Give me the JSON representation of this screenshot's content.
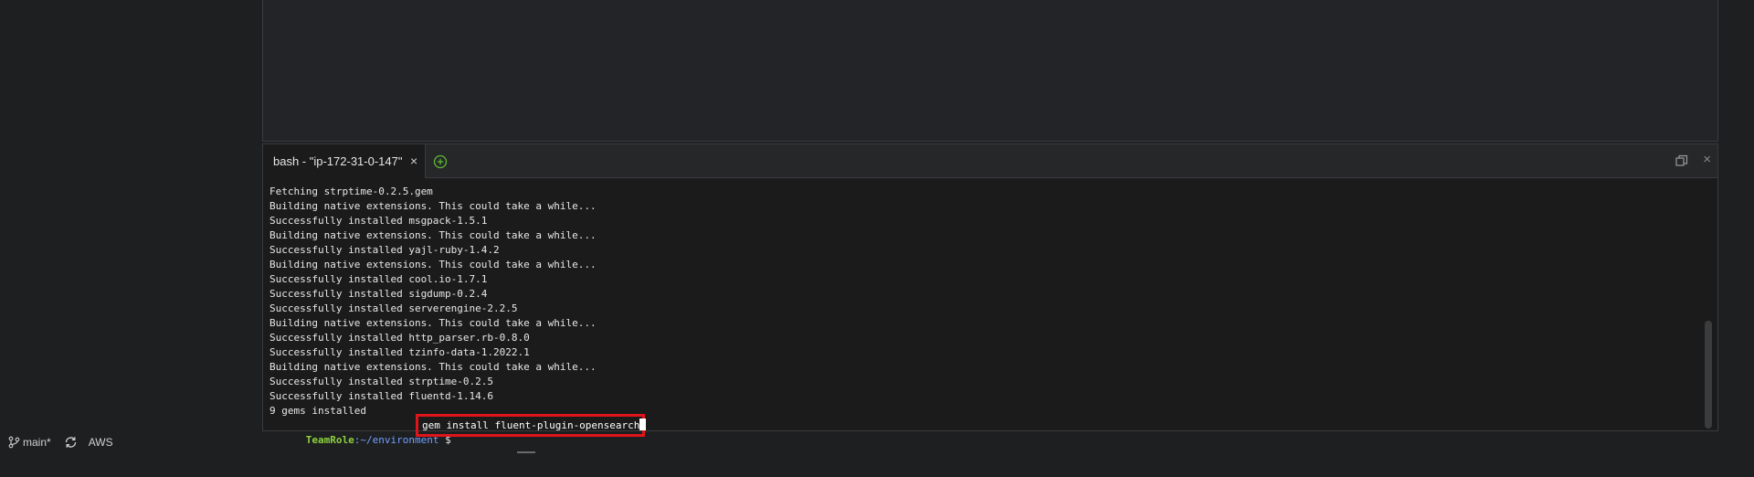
{
  "terminal": {
    "tab_title": "bash - \"ip-172-31-0-147\"",
    "tab_close": "×",
    "panel_close": "×",
    "output_lines": [
      "Fetching strptime-0.2.5.gem",
      "Building native extensions. This could take a while...",
      "Successfully installed msgpack-1.5.1",
      "Building native extensions. This could take a while...",
      "Successfully installed yajl-ruby-1.4.2",
      "Building native extensions. This could take a while...",
      "Successfully installed cool.io-1.7.1",
      "Successfully installed sigdump-0.2.4",
      "Successfully installed serverengine-2.2.5",
      "Building native extensions. This could take a while...",
      "Successfully installed http_parser.rb-0.8.0",
      "Successfully installed tzinfo-data-1.2022.1",
      "Building native extensions. This could take a while...",
      "Successfully installed strptime-0.2.5",
      "Successfully installed fluentd-1.14.6",
      "9 gems installed"
    ],
    "prompt": {
      "user": "TeamRole",
      "path": ":~/environment",
      "symbol": " $ ",
      "command": "gem install fluent-plugin-opensearch"
    },
    "highlight_color": "#e0141b"
  },
  "status_bar": {
    "branch": "main*",
    "provider": "AWS"
  }
}
